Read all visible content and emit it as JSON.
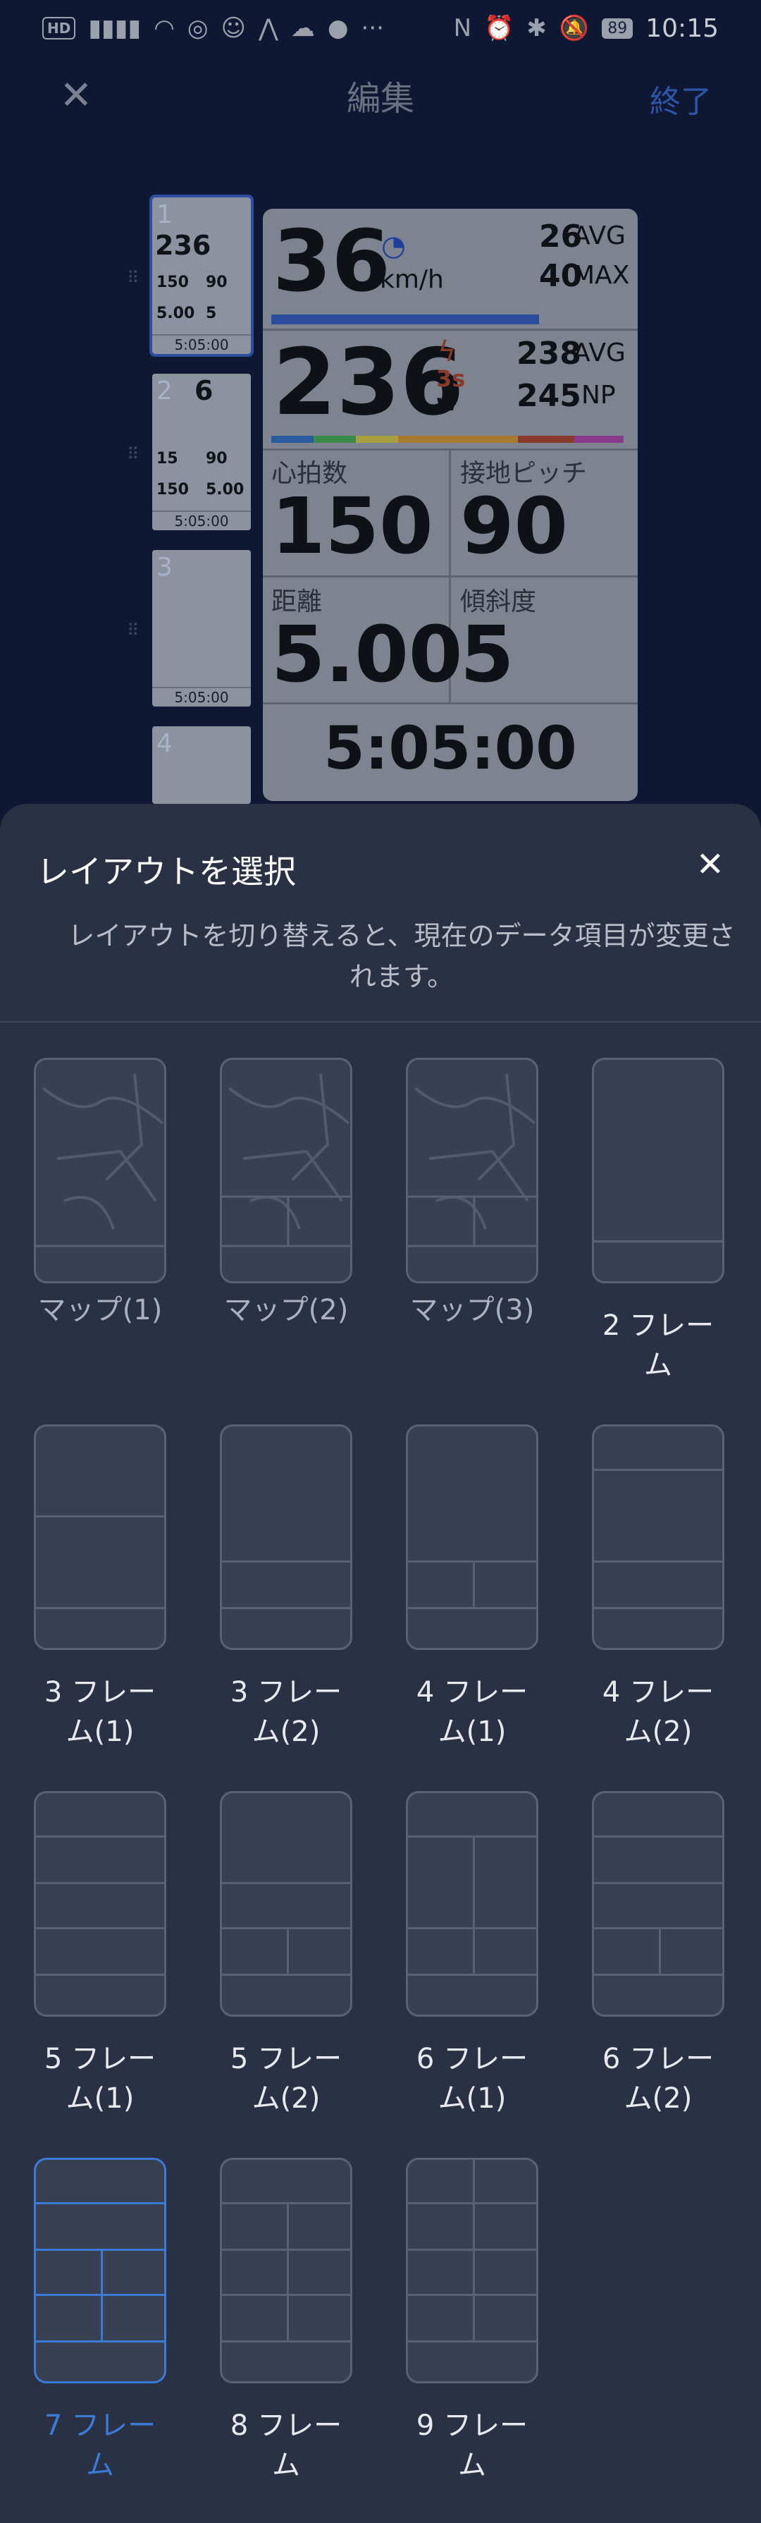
{
  "statusbar": {
    "hd": "HD",
    "battery": "89",
    "time": "10:15"
  },
  "header": {
    "title": "編集",
    "done": "終了"
  },
  "thumbnails": [
    {
      "num": "1",
      "big": "236",
      "a": "150",
      "b": "90",
      "c": "5.00",
      "d": "5",
      "foot": "5:05:00"
    },
    {
      "num": "2",
      "big": "6",
      "a": "15",
      "b": "90",
      "c": "150",
      "d": "5.00",
      "foot": "5:05:00"
    },
    {
      "num": "3",
      "foot": "5:05:00"
    },
    {
      "num": "4"
    }
  ],
  "device": {
    "speed": "36",
    "speed_unit": "km/h",
    "speed_avg": "26",
    "avg_label": "AVG",
    "speed_max": "40",
    "max_label": "MAX",
    "power": "236",
    "power_tag": "3s",
    "power_unit": "w",
    "power_avg": "238",
    "power_avg_label": "AVG",
    "np": "245",
    "np_label": "NP",
    "hr_label": "心拍数",
    "hr": "150",
    "cadence_label": "接地ピッチ",
    "cadence": "90",
    "dist_label": "距離",
    "dist": "5.00",
    "grade_label": "傾斜度",
    "grade": "5",
    "time": "5:05:00"
  },
  "sheet": {
    "title": "レイアウトを選択",
    "desc_line1": "レイアウトを切り替えると、現在のデータ項目が変更さ",
    "desc_line2": "れます。",
    "layouts": [
      {
        "l1": "マップ(1)",
        "l2": ""
      },
      {
        "l1": "マップ(2)",
        "l2": ""
      },
      {
        "l1": "マップ(3)",
        "l2": ""
      },
      {
        "l1": "2 フレー",
        "l2": "ム"
      },
      {
        "l1": "3 フレー",
        "l2": "ム(1)"
      },
      {
        "l1": "3 フレー",
        "l2": "ム(2)"
      },
      {
        "l1": "4 フレー",
        "l2": "ム(1)"
      },
      {
        "l1": "4 フレー",
        "l2": "ム(2)"
      },
      {
        "l1": "5 フレー",
        "l2": "ム(1)"
      },
      {
        "l1": "5 フレー",
        "l2": "ム(2)"
      },
      {
        "l1": "6 フレー",
        "l2": "ム(1)"
      },
      {
        "l1": "6 フレー",
        "l2": "ム(2)"
      },
      {
        "l1": "7 フレー",
        "l2": "ム"
      },
      {
        "l1": "8 フレー",
        "l2": "ム"
      },
      {
        "l1": "9 フレー",
        "l2": "ム"
      }
    ]
  },
  "colors": {
    "accent": "#3a7bd5",
    "sheet_bg": "#2b3145",
    "overlay_bg": "#0f1833"
  }
}
